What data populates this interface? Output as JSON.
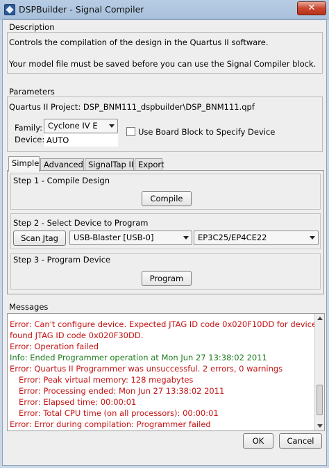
{
  "window": {
    "title": "DSPBuilder - Signal Compiler",
    "close_glyph": "✕"
  },
  "description": {
    "label": "Description",
    "line1": "Controls the compilation of the design in the Quartus II software.",
    "line2": "Your model file must be saved before you can use the Signal Compiler block."
  },
  "parameters": {
    "label": "Parameters",
    "project_line": "Quartus II Project: DSP_BNM111_dspbuilder\\DSP_BNM111.qpf",
    "family_label": "Family:",
    "family_value": "Cyclone IV E",
    "device_label": "Device:",
    "device_value": "AUTO",
    "board_block_label": "Use Board Block to Specify Device",
    "board_block_checked": false
  },
  "tabs": [
    {
      "label": "Simple",
      "active": true
    },
    {
      "label": "Advanced",
      "active": false
    },
    {
      "label": "SignalTap II",
      "active": false
    },
    {
      "label": "Export",
      "active": false
    }
  ],
  "steps": {
    "step1_label": "Step 1 - Compile Design",
    "compile_label": "Compile",
    "step2_label": "Step 2 - Select Device to Program",
    "scan_jtag_label": "Scan Jtag",
    "cable_value": "USB-Blaster [USB-0]",
    "device_select_value": "EP3C25/EP4CE22",
    "step3_label": "Step 3 - Program Device",
    "program_label": "Program"
  },
  "messages": {
    "label": "Messages",
    "lines": [
      {
        "text": "Error: Can't configure device. Expected JTAG ID code 0x020F10DD for device 1, but",
        "level": "error",
        "indent": false
      },
      {
        "text": "found JTAG ID code 0x020F30DD.",
        "level": "error",
        "indent": false
      },
      {
        "text": "Error: Operation failed",
        "level": "error",
        "indent": false
      },
      {
        "text": "Info: Ended Programmer operation at Mon Jun 27 13:38:02 2011",
        "level": "info",
        "indent": false
      },
      {
        "text": "Error: Quartus II Programmer was unsuccessful. 2 errors, 0 warnings",
        "level": "error",
        "indent": false
      },
      {
        "text": "Error: Peak virtual memory: 128 megabytes",
        "level": "error",
        "indent": true
      },
      {
        "text": "Error: Processing ended: Mon Jun 27 13:38:02 2011",
        "level": "error",
        "indent": true
      },
      {
        "text": "Error: Elapsed time: 00:00:01",
        "level": "error",
        "indent": true
      },
      {
        "text": "Error: Total CPU time (on all processors): 00:00:01",
        "level": "error",
        "indent": true
      },
      {
        "text": "Error: Error during compilation: Programmer failed",
        "level": "error",
        "indent": false
      }
    ]
  },
  "footer": {
    "ok_label": "OK",
    "cancel_label": "Cancel"
  },
  "colors": {
    "error": "#c41313",
    "info": "#1d7a1d",
    "titlebar": "#b8cde4"
  }
}
